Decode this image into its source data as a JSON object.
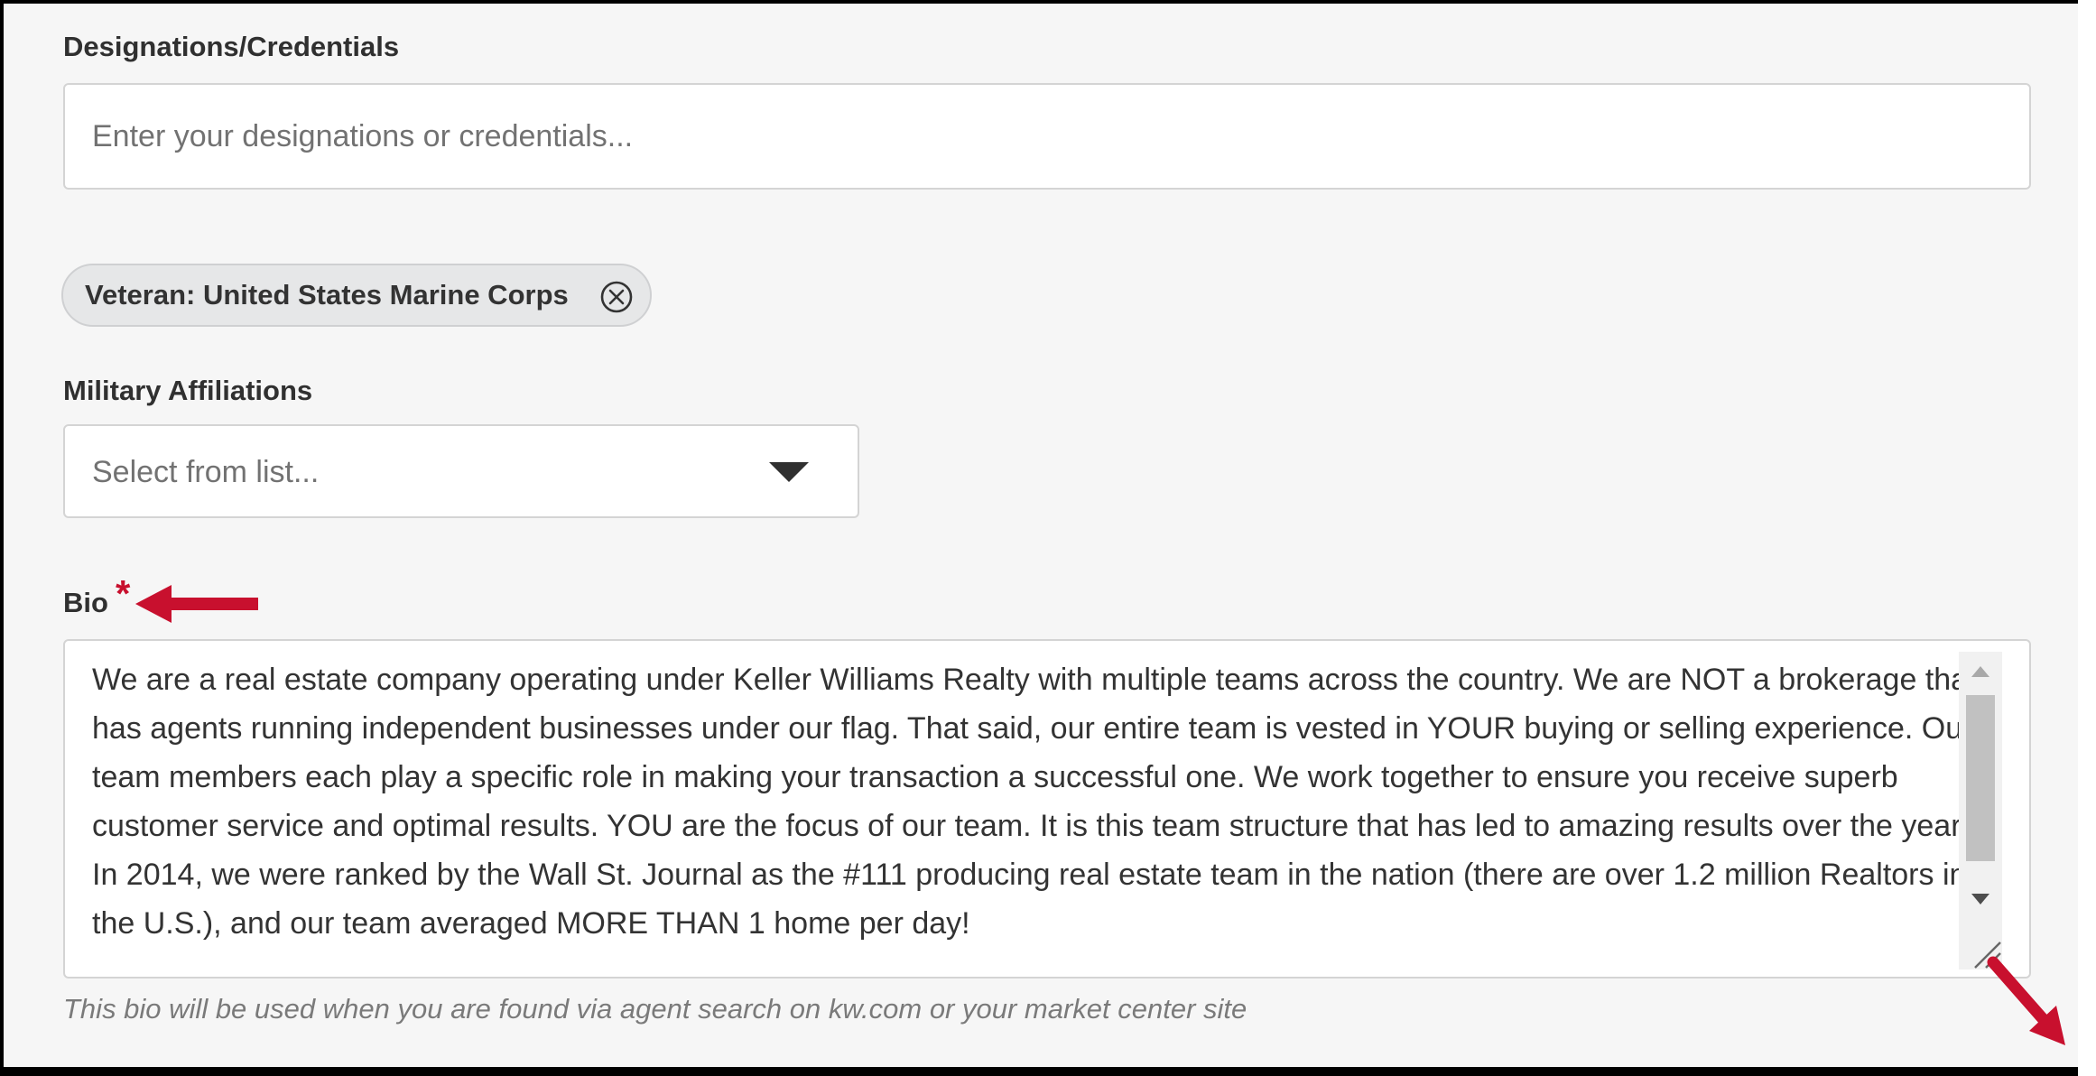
{
  "designations": {
    "label": "Designations/Credentials",
    "placeholder": "Enter your designations or credentials..."
  },
  "selected_affiliation": {
    "label": "Veteran: United States Marine Corps",
    "remove_icon": "circle-x-icon"
  },
  "military": {
    "label": "Military Affiliations",
    "placeholder": "Select from list...",
    "dropdown_icon": "caret-down-icon"
  },
  "bio": {
    "label": "Bio",
    "required_mark": "*",
    "value": "We are a real estate company operating under Keller Williams Realty with multiple teams across the country. We are NOT a brokerage that has agents running independent businesses under our flag. That said, our entire team is vested in YOUR buying or selling experience. Our team members each play a specific role in making your transaction a successful one. We work together to ensure you receive superb customer service and optimal results. YOU are the focus of our team. It is this team structure that has led to amazing results over the years. In 2014, we were ranked by the Wall St. Journal as the #111 producing real estate team in the nation (there are over 1.2 million Realtors in the U.S.), and our team averaged MORE THAN 1 home per day!",
    "helper": "This bio will be used when you are found via agent search on kw.com or your market center site"
  },
  "colors": {
    "page_background": "#f6f6f6",
    "annotation_arrow": "#c8102e",
    "chip_background": "#e6e7e8"
  }
}
